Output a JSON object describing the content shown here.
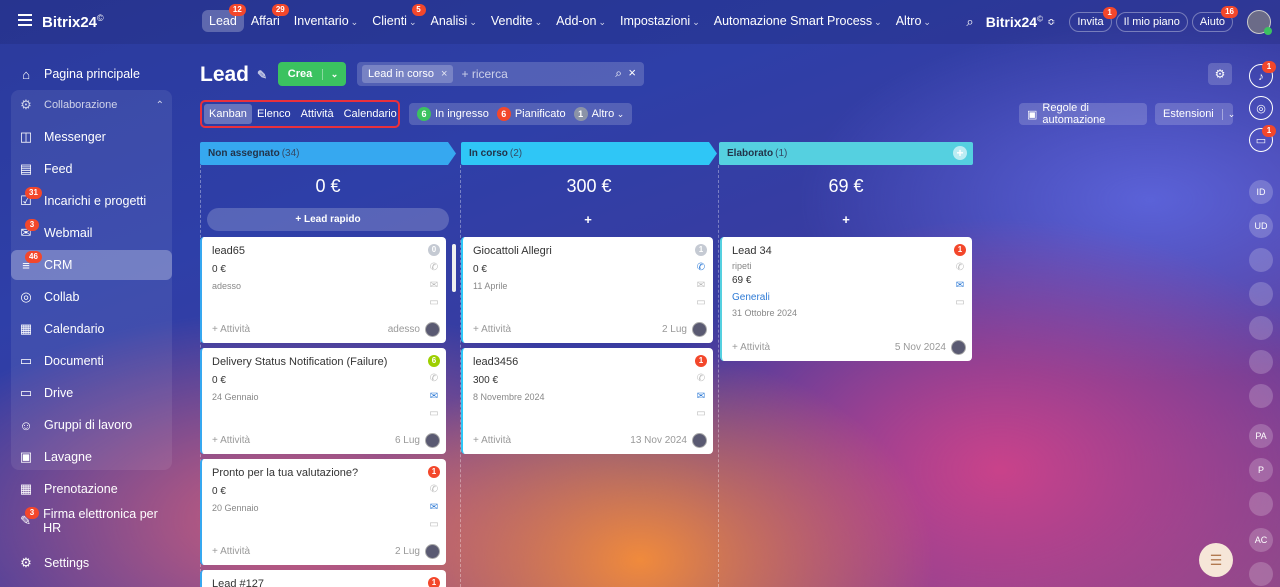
{
  "topbar": {
    "brand": "Bitrix24",
    "brand_mark": "©",
    "nav": [
      {
        "label": "Lead",
        "badge": "12",
        "active": true,
        "chev": false
      },
      {
        "label": "Affari",
        "badge": "29",
        "chev": false
      },
      {
        "label": "Inventario",
        "chev": true
      },
      {
        "label": "Clienti",
        "badge": "5",
        "chev": true
      },
      {
        "label": "Analisi",
        "chev": true
      },
      {
        "label": "Vendite",
        "chev": true
      },
      {
        "label": "Add-on",
        "chev": true
      },
      {
        "label": "Impostazioni",
        "chev": true
      },
      {
        "label": "Automazione Smart Process",
        "chev": true
      },
      {
        "label": "Altro",
        "chev": true
      }
    ],
    "brand_right": "Bitrix24",
    "invita": {
      "label": "Invita",
      "badge": "1"
    },
    "mio_piano": "Il mio piano",
    "aiuto": {
      "label": "Aiuto",
      "badge": "16"
    }
  },
  "sidebar": {
    "items": [
      {
        "label": "Pagina principale",
        "icon": "home-icon",
        "glyph": "⌂"
      },
      {
        "label": "Collaborazione",
        "icon": "collab-icon",
        "glyph": "⚙",
        "dim": true
      },
      {
        "label": "Messenger",
        "icon": "chat-icon",
        "glyph": "◫"
      },
      {
        "label": "Feed",
        "icon": "feed-icon",
        "glyph": "▤"
      },
      {
        "label": "Incarichi e progetti",
        "icon": "task-icon",
        "glyph": "☑",
        "badge": "31"
      },
      {
        "label": "Webmail",
        "icon": "mail-icon",
        "glyph": "✉",
        "badge": "3"
      },
      {
        "label": "CRM",
        "icon": "crm-icon",
        "glyph": "≡",
        "badge": "46",
        "active": true
      },
      {
        "label": "Collab",
        "icon": "collab-circle-icon",
        "glyph": "◎"
      },
      {
        "label": "Calendario",
        "icon": "calendar-icon",
        "glyph": "▦"
      },
      {
        "label": "Documenti",
        "icon": "document-icon",
        "glyph": "▭"
      },
      {
        "label": "Drive",
        "icon": "drive-icon",
        "glyph": "▭"
      },
      {
        "label": "Gruppi di lavoro",
        "icon": "groups-icon",
        "glyph": "☺"
      },
      {
        "label": "Lavagne",
        "icon": "board-icon",
        "glyph": "▣"
      },
      {
        "label": "Prenotazione",
        "icon": "booking-icon",
        "glyph": "▦"
      },
      {
        "label": "Firma elettronica per HR",
        "icon": "signature-icon",
        "glyph": "✎",
        "badge": "3"
      },
      {
        "label": "Settings",
        "icon": "settings-icon",
        "glyph": "⚙"
      }
    ]
  },
  "header": {
    "title": "Lead",
    "crea": "Crea",
    "search_tag": "Lead in corso",
    "search_placeholder": "+ ricerca",
    "views": [
      "Kanban",
      "Elenco",
      "Attività",
      "Calendario"
    ],
    "filters": [
      {
        "count": "6",
        "label": "In ingresso",
        "color": "#3bc260"
      },
      {
        "count": "6",
        "label": "Pianificato",
        "color": "#f3472b"
      },
      {
        "count": "1",
        "label": "Altro",
        "color": "#8b93a7",
        "chev": true
      }
    ],
    "regole": "Regole di automazione",
    "estensioni": "Estensioni"
  },
  "columns": [
    {
      "name": "Non assegnato",
      "count": "(34)",
      "color": "#36a8f0",
      "total": "0 €",
      "add": "+ Lead rapido"
    },
    {
      "name": "In corso",
      "count": "(2)",
      "color": "#2fc6f6",
      "total": "300 €",
      "add": "+"
    },
    {
      "name": "Elaborato",
      "count": "(1)",
      "color": "#55d0e0",
      "total": "69 €",
      "add": "+"
    }
  ],
  "cards": [
    {
      "col": 0,
      "title": "lead65",
      "amount": "0 €",
      "date": "adesso",
      "act": "+ Attività",
      "foot": "adesso",
      "badge": "0",
      "badge_color": "#c5cad3",
      "phone_blue": false,
      "mail_blue": false
    },
    {
      "col": 0,
      "title": "Delivery Status Notification (Failure)",
      "amount": "0 €",
      "date": "24 Gennaio",
      "act": "+ Attività",
      "foot": "6 Lug",
      "badge": "6",
      "badge_color": "#9dcf00",
      "phone_blue": false,
      "mail_blue": true
    },
    {
      "col": 0,
      "title": "Pronto per la tua valutazione?",
      "amount": "0 €",
      "date": "20 Gennaio",
      "act": "+ Attività",
      "foot": "2 Lug",
      "badge": "1",
      "badge_color": "#f3472b",
      "phone_blue": false,
      "mail_blue": true
    },
    {
      "col": 0,
      "title": "Lead #127",
      "badge": "1",
      "badge_color": "#f3472b",
      "partial": true
    },
    {
      "col": 1,
      "title": "Giocattoli Allegri",
      "amount": "0 €",
      "date": "11 Aprile",
      "act": "+ Attività",
      "foot": "2 Lug",
      "badge": "1",
      "badge_color": "#c5cad3",
      "phone_blue": true,
      "mail_blue": false
    },
    {
      "col": 1,
      "title": "lead3456",
      "amount": "300 €",
      "date": "8 Novembre 2024",
      "act": "+ Attività",
      "foot": "13 Nov 2024",
      "badge": "1",
      "badge_color": "#f3472b",
      "phone_blue": false,
      "mail_blue": true
    },
    {
      "col": 2,
      "title": "Lead 34",
      "sub": "ripeti",
      "amount": "69 €",
      "link": "Generali",
      "date": "31 Ottobre 2024",
      "act": "+ Attività",
      "foot": "5 Nov 2024",
      "badge": "1",
      "badge_color": "#f3472b",
      "phone_blue": false,
      "mail_blue": true
    }
  ],
  "rail": [
    {
      "label": "",
      "icon": "bell-icon",
      "badge": "1"
    },
    {
      "label": "",
      "icon": "copilot-icon"
    },
    {
      "label": "",
      "icon": "chat-ai-icon",
      "badge": "1"
    },
    {
      "label": "ID",
      "icon": "avatar-id"
    },
    {
      "label": "UD",
      "icon": "avatar-ud"
    },
    {
      "label": "",
      "icon": "group-avatar-icon"
    },
    {
      "label": "",
      "icon": "photo-avatar-icon"
    },
    {
      "label": "",
      "icon": "group-avatar-icon"
    },
    {
      "label": "",
      "icon": "chat-bubble-icon"
    },
    {
      "label": "",
      "icon": "group-avatar-icon"
    },
    {
      "label": "PA",
      "icon": "avatar-pa"
    },
    {
      "label": "P",
      "icon": "avatar-p"
    },
    {
      "label": "",
      "icon": "note-icon"
    },
    {
      "label": "AC",
      "icon": "avatar-ac"
    },
    {
      "label": "",
      "icon": "video-icon"
    }
  ]
}
